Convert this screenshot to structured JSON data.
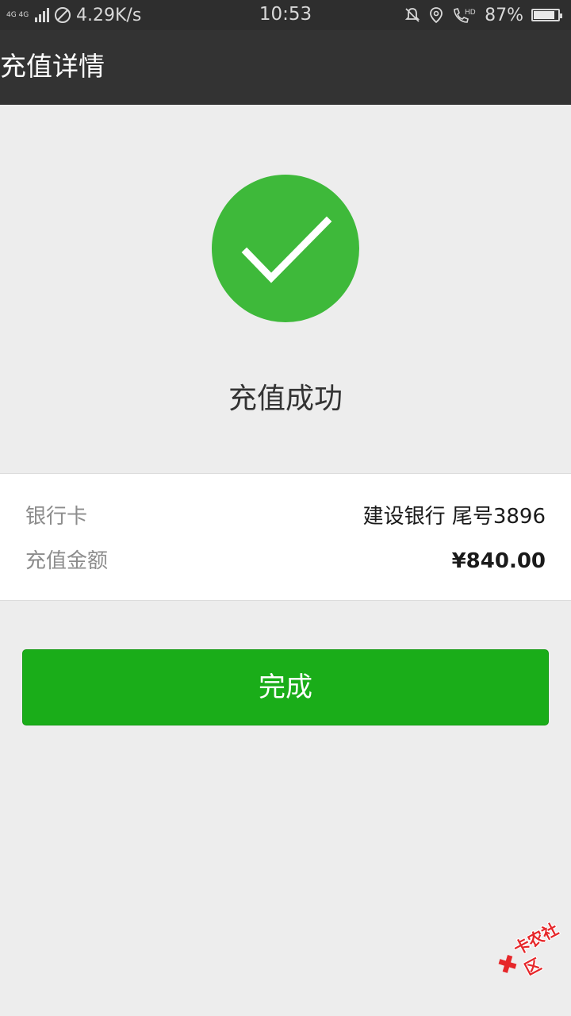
{
  "status_bar": {
    "network_label": "4G 4G",
    "speed": "4.29K/s",
    "time": "10:53",
    "battery_percent": "87%",
    "battery_level": 0.87,
    "icons": [
      "signal-icon",
      "no-sim-icon",
      "mute-icon",
      "location-icon",
      "hd-call-icon",
      "battery-icon"
    ]
  },
  "header": {
    "title": "充值详情"
  },
  "result": {
    "icon": "check-circle-icon",
    "icon_color": "#3eb93a",
    "title": "充值成功"
  },
  "details": {
    "rows": [
      {
        "label": "银行卡",
        "value": "建设银行 尾号3896"
      },
      {
        "label": "充值金额",
        "value": "¥840.00"
      }
    ]
  },
  "actions": {
    "done_label": "完成",
    "button_color": "#1aad19"
  },
  "watermark": {
    "text": "卡农社区"
  }
}
